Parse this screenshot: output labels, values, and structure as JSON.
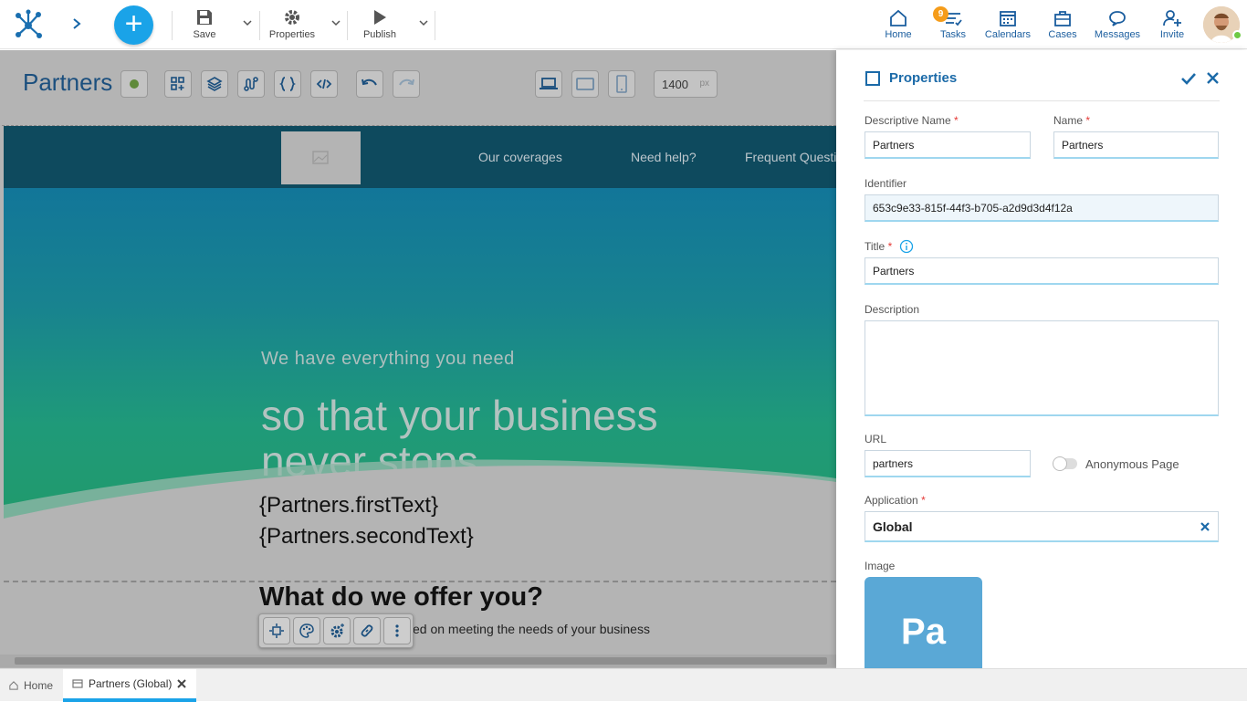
{
  "topbar": {
    "tools": [
      {
        "label": "Save",
        "icon": "save-icon"
      },
      {
        "label": "Properties",
        "icon": "gear-icon"
      },
      {
        "label": "Publish",
        "icon": "play-icon"
      }
    ],
    "nav": [
      {
        "label": "Home",
        "icon": "home-icon"
      },
      {
        "label": "Tasks",
        "icon": "tasks-icon"
      },
      {
        "label": "Calendars",
        "icon": "calendar-icon"
      },
      {
        "label": "Cases",
        "icon": "briefcase-icon"
      },
      {
        "label": "Messages",
        "icon": "chat-icon"
      },
      {
        "label": "Invite",
        "icon": "add-user-icon"
      }
    ],
    "tasks_badge": "9"
  },
  "editor": {
    "page_title": "Partners",
    "width_value": "1400",
    "width_unit": "px"
  },
  "site": {
    "menu": [
      "Our coverages",
      "Need help?",
      "Frequent Questi"
    ],
    "hero_small": "We have everything you need",
    "hero_big": "so that your business never stops",
    "first_text": "{Partners.firstText}",
    "second_text": "{Partners.secondText}",
    "offer_title": "What do we offer you?",
    "offer_sub": "ed on meeting the needs of your business"
  },
  "panel": {
    "title": "Properties",
    "descriptive_name_label": "Descriptive Name",
    "descriptive_name": "Partners",
    "name_label": "Name",
    "name": "Partners",
    "identifier_label": "Identifier",
    "identifier": "653c9e33-815f-44f3-b705-a2d9d3d4f12a",
    "title_label": "Title",
    "title_value": "Partners",
    "description_label": "Description",
    "description": "",
    "url_label": "URL",
    "url": "partners",
    "anonymous_label": "Anonymous Page",
    "application_label": "Application",
    "application": "Global",
    "image_label": "Image",
    "image_initials": "Pa",
    "required_mark": "*"
  },
  "tabs": [
    {
      "label": "Home"
    },
    {
      "label": "Partners (Global)"
    }
  ],
  "colors": {
    "accent": "#1aa3e8",
    "brand_blue": "#1b6aa8",
    "hero_top": "#127699",
    "hero_bottom": "#219a6b"
  }
}
